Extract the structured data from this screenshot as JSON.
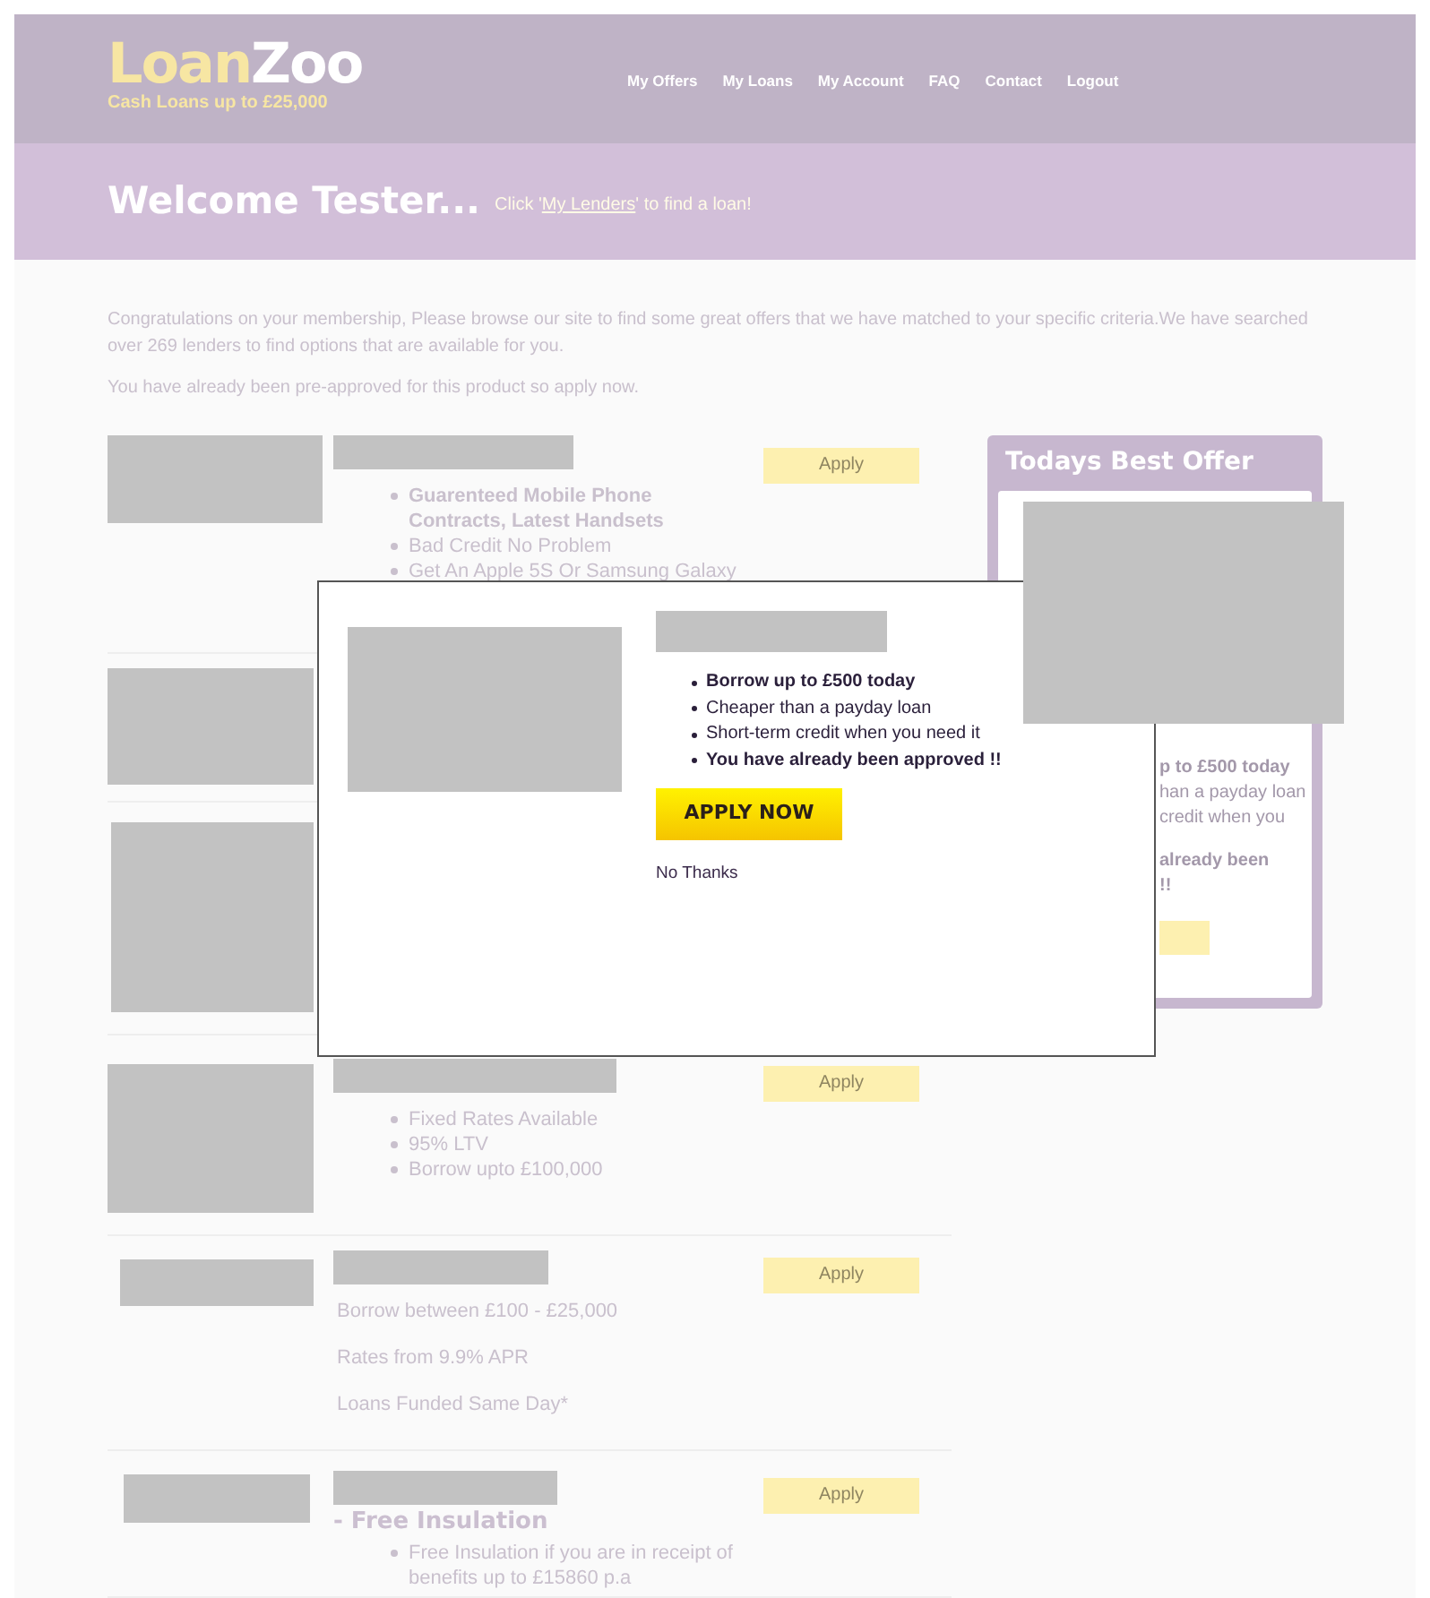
{
  "header": {
    "logo": [
      "Loan",
      "Zoo"
    ],
    "tagline": "Cash Loans up to £25,000",
    "nav": [
      "My Offers",
      "My Loans",
      "My Account",
      "FAQ",
      "Contact",
      "Logout"
    ]
  },
  "banner": {
    "title": "Welcome Tester...",
    "hint_before": "Click '",
    "link": "My Lenders",
    "hint_after": "' to find a loan!"
  },
  "intro": [
    "Congratulations on your membership, Please browse our site to find some great offers that we have matched to your specific criteria.We have searched over 269 lenders to find options that are available for you.",
    "You have already been pre-approved for this product so apply now."
  ],
  "offers": [
    {
      "kind": "bullets",
      "apply": "Apply",
      "items": [
        {
          "text": "Guarenteed Mobile Phone Contracts, Latest Handsets",
          "bold": true
        },
        {
          "text": "Bad Credit No Problem",
          "bold": false
        },
        {
          "text": "Get An Apple 5S Or Samsung Galaxy",
          "bold": false
        }
      ]
    },
    {
      "kind": "hidden"
    },
    {
      "kind": "hidden"
    },
    {
      "kind": "bullets",
      "apply": "Apply",
      "items": [
        {
          "text": "Fixed Rates Available",
          "bold": false
        },
        {
          "text": "95% LTV",
          "bold": false
        },
        {
          "text": "Borrow upto £100,000",
          "bold": false
        }
      ]
    },
    {
      "kind": "lines",
      "apply": "Apply",
      "items": [
        {
          "text": "Borrow between £100 - £25,000",
          "bold": false
        },
        {
          "text": "Rates from 9.9% APR",
          "bold": false
        },
        {
          "text": "Loans Funded Same Day*",
          "bold": false
        }
      ]
    },
    {
      "kind": "bullets",
      "apply": "Apply",
      "title_suffix": "- Free Insulation",
      "items": [
        {
          "text": "Free Insulation if you are in receipt of benefits up to £15860 p.a",
          "bold": false
        }
      ]
    }
  ],
  "sidebar": {
    "title": "Todays Best Offer",
    "fragments": [
      {
        "text": "p to £500 today",
        "bold": true
      },
      {
        "text": "han a payday loan",
        "bold": false
      },
      {
        "text": "credit when you",
        "bold": false
      },
      {
        "text": "already been",
        "bold": true
      },
      {
        "text": "!!",
        "bold": true
      }
    ]
  },
  "modal": {
    "bullets": [
      {
        "text": "Borrow up to £500 today",
        "bold": true
      },
      {
        "text": "Cheaper than a payday loan",
        "bold": false
      },
      {
        "text": "Short-term credit when you need it",
        "bold": false
      },
      {
        "text": "You have already been approved !!",
        "bold": true
      }
    ],
    "button": "APPLY NOW",
    "dismiss": "No Thanks"
  }
}
